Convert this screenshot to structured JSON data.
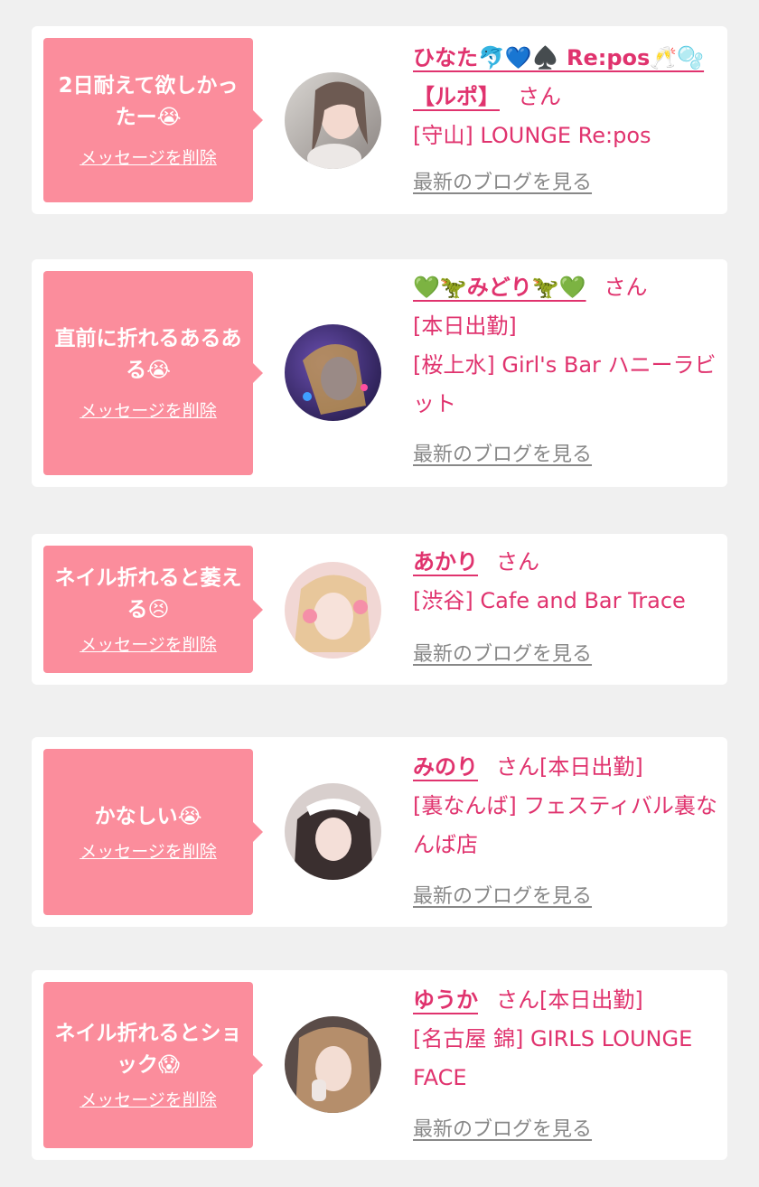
{
  "ui": {
    "delete_label": "メッセージを削除",
    "blog_label": "最新のブログを見る",
    "san_label": "さん"
  },
  "entries": [
    {
      "message": "2日耐えて欲しかったー😭",
      "name": "ひなた🐬💙♠️ Re:pos🥂🫧【ルポ】",
      "inline": "",
      "lines": [
        "[守山] LOUNGE Re:pos"
      ]
    },
    {
      "message": "直前に折れるあるある😭",
      "name": "💚🦖みどり🦖💚",
      "inline": "",
      "lines": [
        "[本日出勤]",
        "[桜上水] Girl's Bar ハニーラビット"
      ]
    },
    {
      "message": "ネイル折れると萎える😣",
      "name": "あかり",
      "inline": "",
      "lines": [
        "[渋谷] Cafe and Bar Trace"
      ]
    },
    {
      "message": "かなしい😭",
      "name": "みのり",
      "inline": "[本日出勤]",
      "lines": [
        "[裏なんば] フェスティバル裏なんば店"
      ]
    },
    {
      "message": "ネイル折れるとショック😱",
      "name": "ゆうか",
      "inline": "[本日出勤]",
      "lines": [
        "[名古屋 錦] GIRLS LOUNGE FACE"
      ]
    }
  ],
  "colors": {
    "background": "#f0f0f0",
    "card": "#ffffff",
    "bubble": "#fb8d9c",
    "accent": "#e0336e",
    "link_gray": "#888888"
  }
}
